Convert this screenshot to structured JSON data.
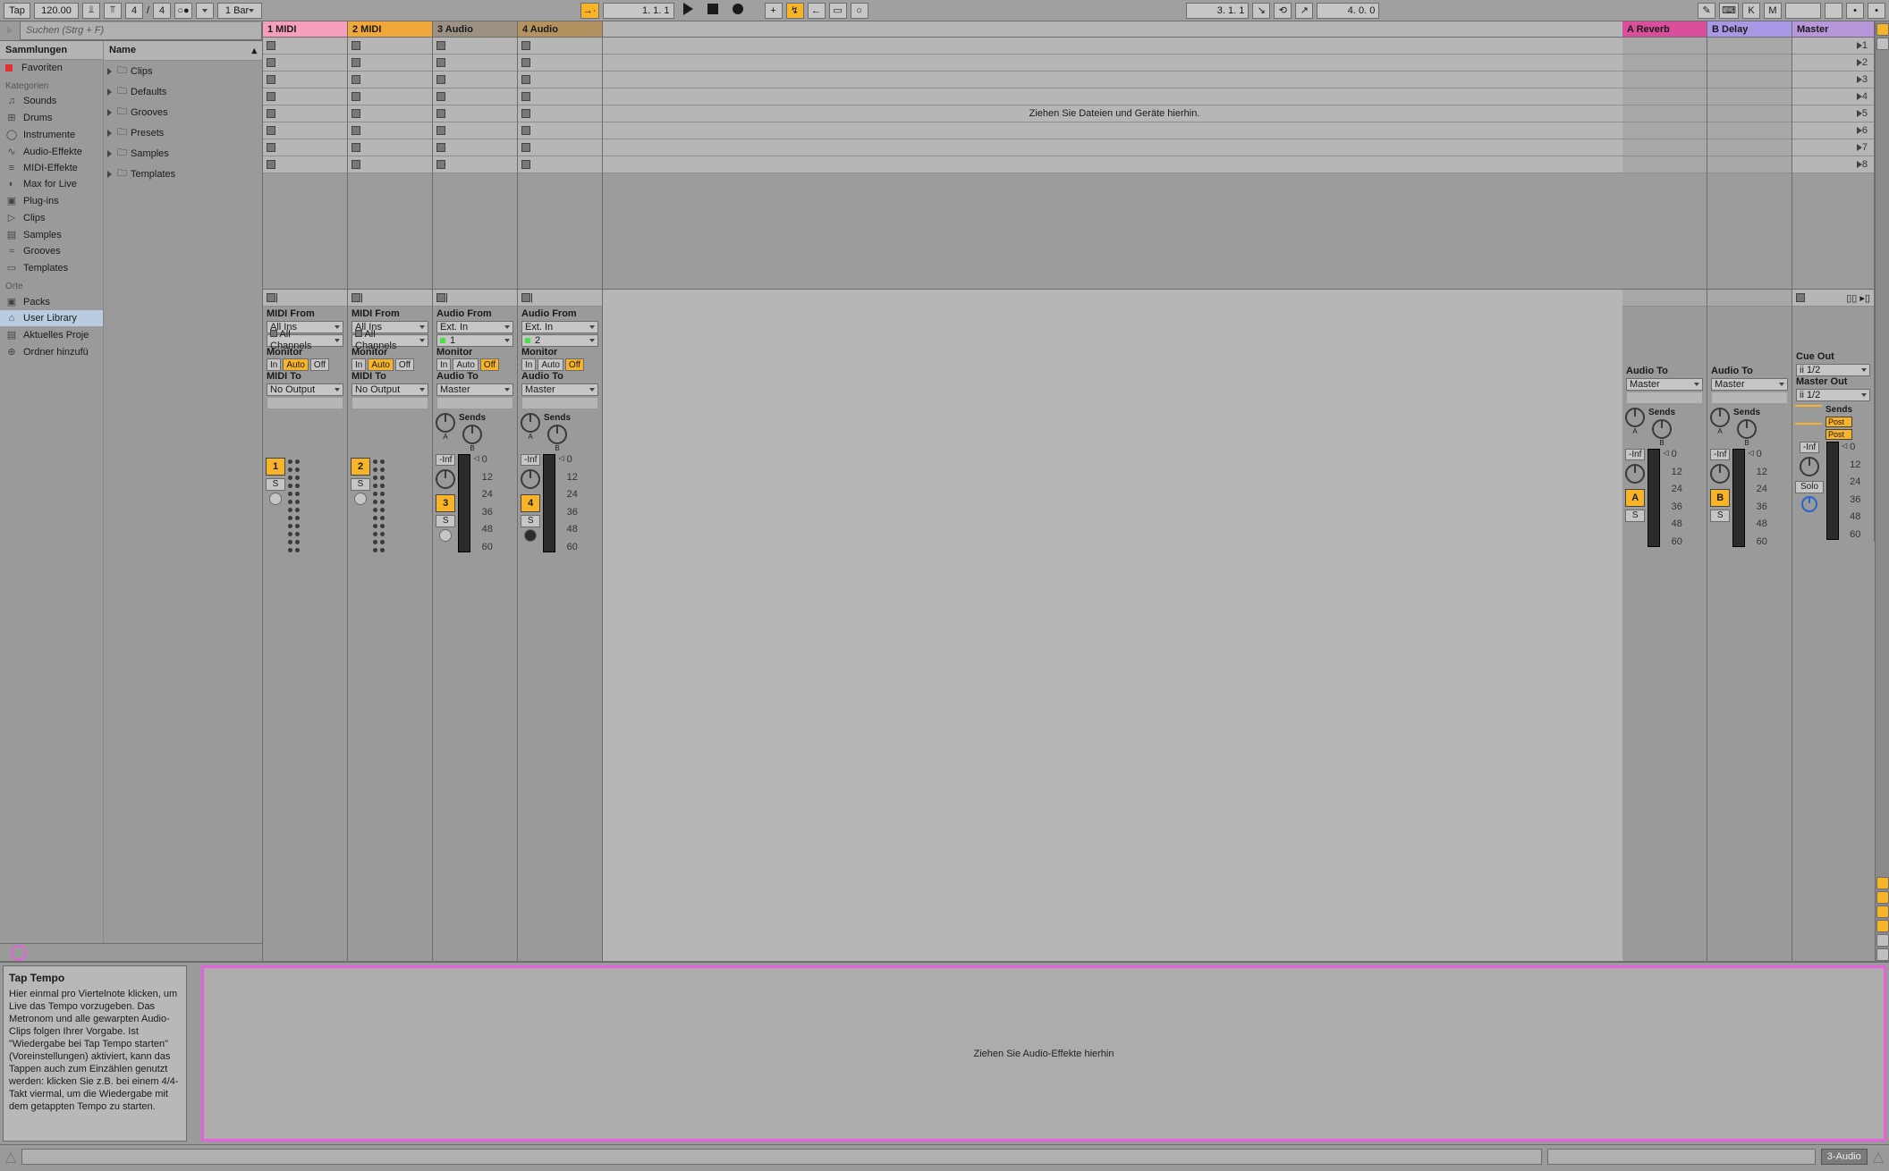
{
  "topbar": {
    "tap": "Tap",
    "tempo": "120.00",
    "sig_num": "4",
    "sig_sep": "/",
    "sig_den": "4",
    "quantize": "1 Bar",
    "position": "1.  1.  1",
    "loop_pos": "3.  1.  1",
    "loop_len": "4.  0.  0"
  },
  "browser": {
    "search_placeholder": "Suchen (Strg + F)",
    "col1_header": "Sammlungen",
    "col2_header": "Name",
    "favorites": "Favoriten",
    "cat_label": "Kategorien",
    "cats": [
      "Sounds",
      "Drums",
      "Instrumente",
      "Audio-Effekte",
      "MIDI-Effekte",
      "Max for Live",
      "Plug-ins",
      "Clips",
      "Samples",
      "Grooves",
      "Templates"
    ],
    "places_label": "Orte",
    "places": [
      "Packs",
      "User Library",
      "Aktuelles Proje",
      "Ordner hinzufü"
    ],
    "sel_place_idx": 1,
    "folders": [
      "Clips",
      "Defaults",
      "Grooves",
      "Presets",
      "Samples",
      "Templates"
    ]
  },
  "tracks": [
    {
      "name": "1 MIDI",
      "color": "pink",
      "from_label": "MIDI From",
      "from": "All Ins",
      "chan": "All Channels",
      "monitor": "Auto",
      "to_label": "MIDI To",
      "to": "No Output",
      "num": "1",
      "midi": true
    },
    {
      "name": "2 MIDI",
      "color": "orange",
      "from_label": "MIDI From",
      "from": "All Ins",
      "chan": "All Channels",
      "monitor": "Auto",
      "to_label": "MIDI To",
      "to": "No Output",
      "num": "2",
      "midi": true
    },
    {
      "name": "3 Audio",
      "color": "grey",
      "from_label": "Audio From",
      "from": "Ext. In",
      "chan": "1",
      "monitor": "Off",
      "to_label": "Audio To",
      "to": "Master",
      "num": "3",
      "midi": false
    },
    {
      "name": "4 Audio",
      "color": "brown",
      "from_label": "Audio From",
      "from": "Ext. In",
      "chan": "2",
      "monitor": "Off",
      "to_label": "Audio To",
      "to": "Master",
      "num": "4",
      "midi": false
    }
  ],
  "drop_hint": "Ziehen Sie Dateien und Geräte hierhin.",
  "returns": [
    {
      "name": "A Reverb",
      "color": "magenta",
      "to": "Master",
      "letter": "A"
    },
    {
      "name": "B Delay",
      "color": "purple",
      "to": "Master",
      "letter": "B"
    }
  ],
  "master": {
    "name": "Master",
    "cue_label": "Cue Out",
    "cue": "ii 1/2",
    "out_label": "Master Out",
    "out": "ii 1/2",
    "solo": "Solo"
  },
  "io": {
    "monitor": "Monitor",
    "in": "In",
    "auto": "Auto",
    "off": "Off",
    "sends": "Sends",
    "audio_to": "Audio To",
    "post": "Post"
  },
  "mixer": {
    "inf": "-Inf",
    "S": "S",
    "scale": [
      "0",
      "12",
      "24",
      "36",
      "48",
      "60"
    ]
  },
  "scene_count": 8,
  "info": {
    "title": "Tap Tempo",
    "body": "Hier einmal pro Viertelnote klicken, um Live das Tempo vorzugeben. Das Metronom und alle gewarpten Audio-Clips folgen Ihrer Vorgabe. Ist \"Wiedergabe bei Tap Tempo starten\" (Voreinstellungen) aktiviert, kann das Tappen auch zum Einzählen genutzt werden: klicken Sie z.B. bei einem 4/4-Takt viermal, um die Wiedergabe mit dem getappten Tempo zu starten."
  },
  "device_hint": "Ziehen Sie Audio-Effekte hierhin",
  "status": {
    "chip": "3-Audio"
  }
}
